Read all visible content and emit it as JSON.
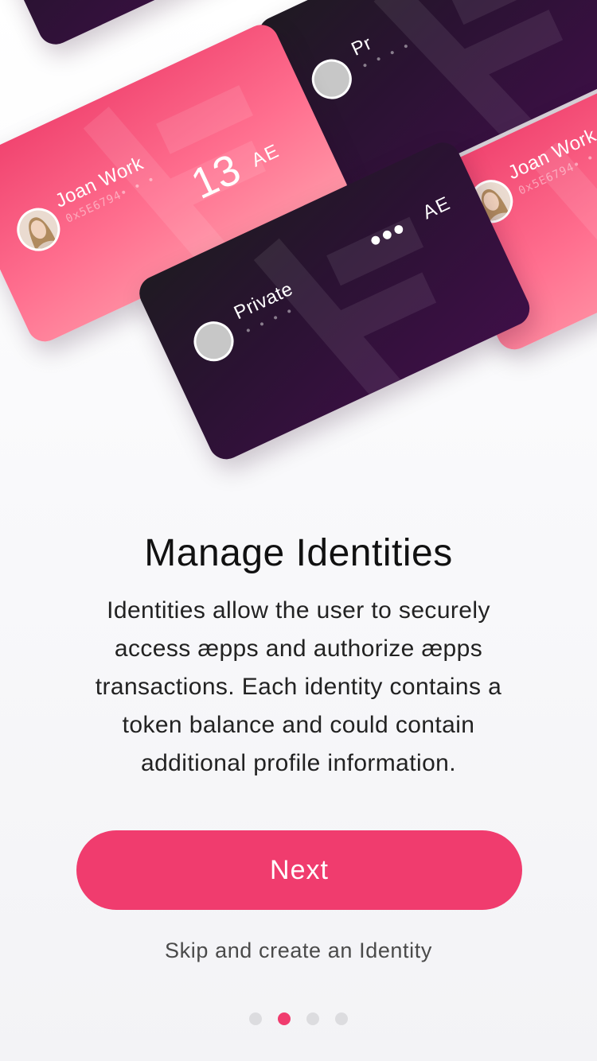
{
  "onboarding": {
    "title": "Manage Identities",
    "description": "Identities allow the user to securely access æpps and authorize æpps transactions. Each identity contains a token balance and could contain additional profile information.",
    "next_label": "Next",
    "skip_label": "Skip and create an Identity",
    "page_count": 4,
    "active_page": 2
  },
  "cards": {
    "top_left": {
      "name": "",
      "style": "dark"
    },
    "top_right": {
      "name": "Pr",
      "address": "• • • •",
      "style": "dark"
    },
    "joan_left": {
      "name": "Joan Work",
      "address": "0x5E6794• • •",
      "balance": "13",
      "currency": "AE",
      "style": "pink"
    },
    "joan_right": {
      "name": "Joan Work",
      "address": "0x5E6794• • •",
      "style": "pink"
    },
    "private": {
      "name": "Private",
      "address": "• • • •",
      "balance_hidden": "•••",
      "currency": "AE",
      "style": "dark"
    }
  },
  "colors": {
    "accent": "#f03c6e",
    "pink_card": "#ff6f8f",
    "dark_card": "#2b1233",
    "dot_inactive": "#dcdcdf"
  },
  "icons": {
    "watermark": "aeternity-logo-icon",
    "avatar_empty": "avatar-placeholder-icon",
    "avatar_photo": "user-photo-icon"
  }
}
